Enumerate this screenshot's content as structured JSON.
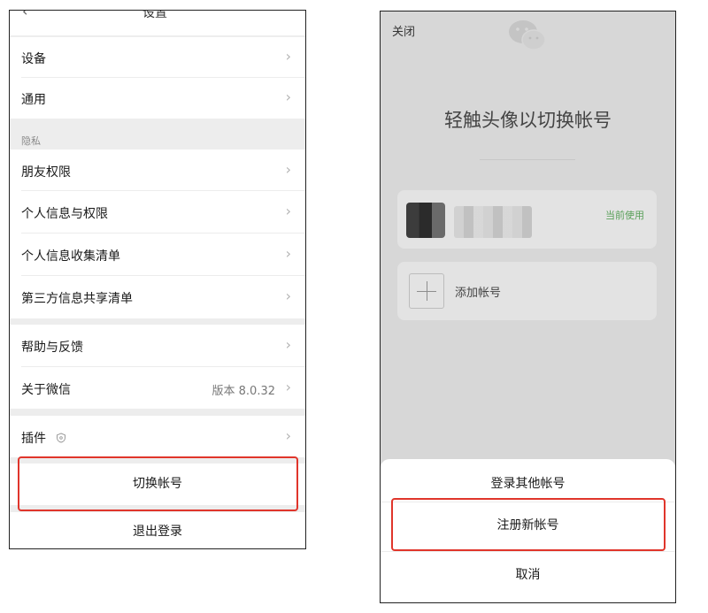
{
  "left": {
    "nav_title": "设置",
    "nav_back": "‹",
    "items": {
      "devices": "设备",
      "general": "通用",
      "privacy_header": "隐私",
      "friend_permissions": "朋友权限",
      "personal_info_permissions": "个人信息与权限",
      "personal_info_collection": "个人信息收集清单",
      "third_party_sharing": "第三方信息共享清单",
      "help_feedback": "帮助与反馈",
      "about": "关于微信",
      "about_version": "版本 8.0.32",
      "plugins": "插件"
    },
    "switch_account": "切换帐号",
    "logout": "退出登录",
    "chevron": "›"
  },
  "right": {
    "close": "关闭",
    "heading": "轻触头像以切换帐号",
    "current_use": "当前使用",
    "add_account": "添加帐号",
    "sheet": {
      "login_other": "登录其他帐号",
      "register_new": "注册新帐号",
      "cancel": "取消"
    }
  },
  "colors": {
    "highlight": "#e0352b",
    "current_use_green": "#5aa05a"
  }
}
